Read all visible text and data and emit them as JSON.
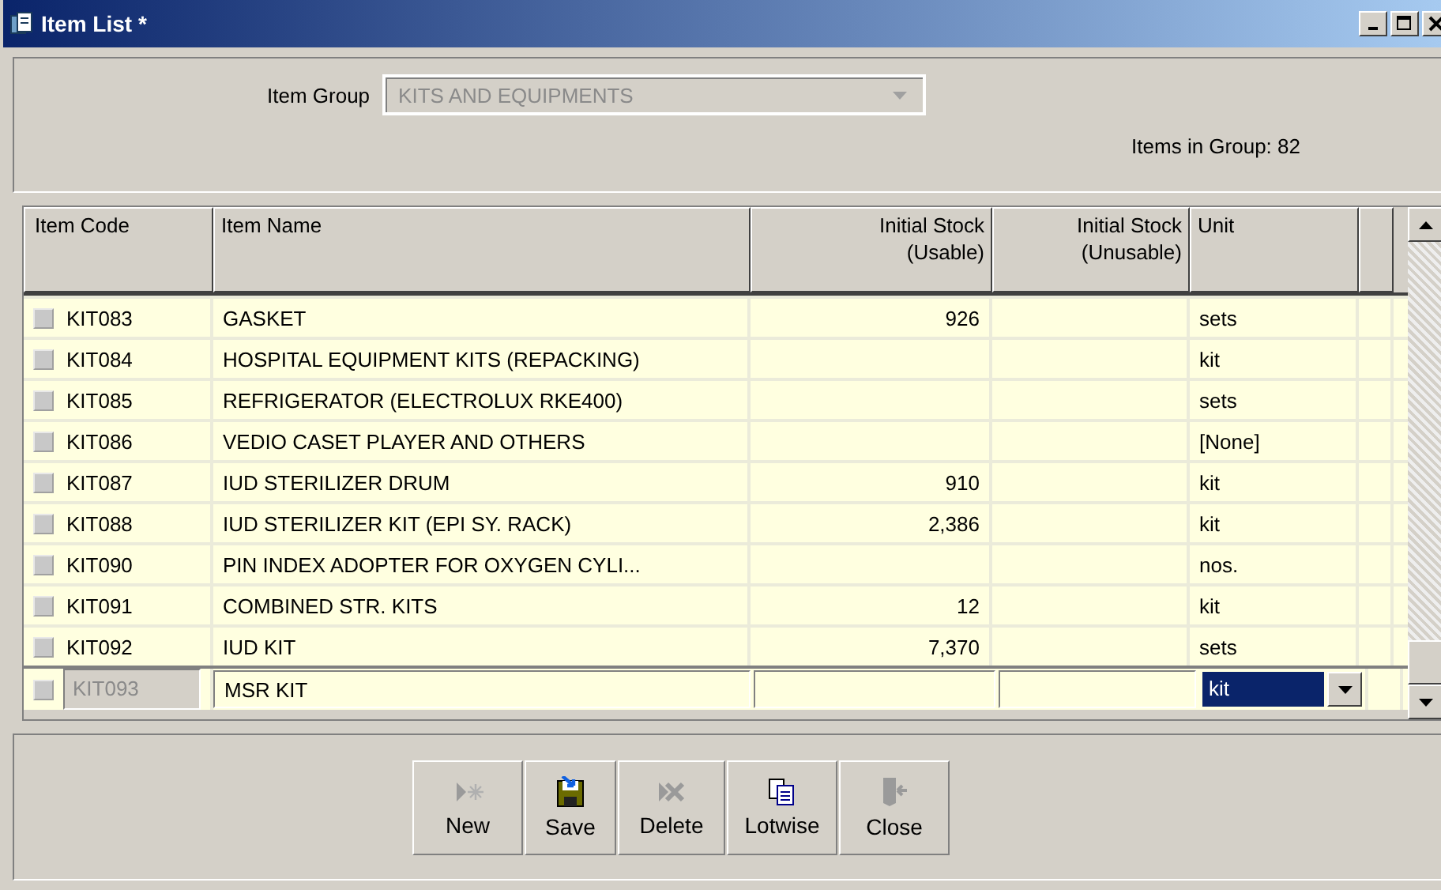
{
  "window": {
    "title": "Item List *"
  },
  "filter": {
    "label": "Item Group",
    "value": "KITS AND EQUIPMENTS",
    "disabled": true,
    "count_label": "Items in Group: 82"
  },
  "table": {
    "columns": [
      {
        "label": "Item Code"
      },
      {
        "label": "Item Name"
      },
      {
        "label": "Initial Stock (Usable)"
      },
      {
        "label": "Initial Stock (Unusable)"
      },
      {
        "label": "Unit"
      }
    ],
    "rows": [
      {
        "code": "KIT083",
        "name": "GASKET",
        "usable": "926",
        "unit": "sets",
        "editing": false
      },
      {
        "code": "KIT084",
        "name": "HOSPITAL EQUIPMENT KITS (REPACKING)",
        "unit": "kit",
        "editing": false
      },
      {
        "code": "KIT085",
        "name": "REFRIGERATOR (ELECTROLUX RKE400)",
        "unit": "sets",
        "editing": false
      },
      {
        "code": "KIT086",
        "name": "VEDIO CASET PLAYER AND OTHERS",
        "unit": "[None]",
        "editing": false
      },
      {
        "code": "KIT087",
        "name": "IUD STERILIZER DRUM",
        "usable": "910",
        "unit": "kit",
        "editing": false
      },
      {
        "code": "KIT088",
        "name": "IUD STERILIZER KIT (EPI SY. RACK)",
        "usable": "2,386",
        "unit": "kit",
        "editing": false
      },
      {
        "code": "KIT090",
        "name": "PIN INDEX ADOPTER FOR OXYGEN CYLI...",
        "unit": "nos.",
        "editing": false
      },
      {
        "code": "KIT091",
        "name": "COMBINED STR. KITS",
        "usable": "12",
        "unit": "kit",
        "editing": false
      },
      {
        "code": "KIT092",
        "name": "IUD KIT",
        "usable": "7,370",
        "unit": "sets",
        "editing": false
      },
      {
        "code": "KIT093",
        "name": "MSR KIT",
        "unit": "kit",
        "editing": true
      }
    ]
  },
  "toolbar": [
    {
      "label": "New",
      "kind": "new",
      "disabled": true
    },
    {
      "label": "Save",
      "kind": "save",
      "disabled": false
    },
    {
      "label": "Delete",
      "kind": "delete",
      "disabled": true
    },
    {
      "label": "Lotwise",
      "kind": "lotwise",
      "disabled": false
    },
    {
      "label": "Close",
      "kind": "close",
      "disabled": true
    }
  ]
}
